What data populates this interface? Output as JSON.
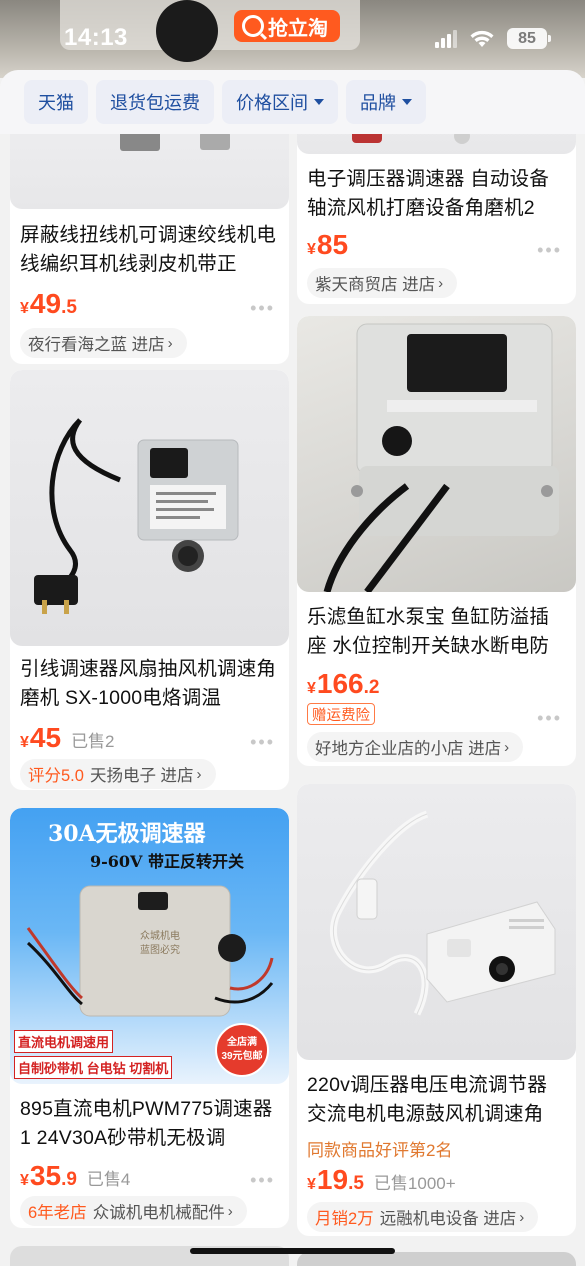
{
  "status": {
    "time": "14:13",
    "app_badge": "抢立淘",
    "battery": "85"
  },
  "filters": [
    {
      "label": "天猫",
      "dropdown": false
    },
    {
      "label": "退货包运费",
      "dropdown": false
    },
    {
      "label": "价格区间",
      "dropdown": true
    },
    {
      "label": "品牌",
      "dropdown": true
    }
  ],
  "products": [
    {
      "title": "屏蔽线扭线机可调速绞线机电线编织耳机线剥皮机带正",
      "price_currency": "¥",
      "price_int": "49",
      "price_dec": ".5",
      "sold": "",
      "shop_highlight": "",
      "shop": "夜行看海之蓝 进店",
      "tag": "",
      "rank": ""
    },
    {
      "title": "电子调压器调速器 自动设备轴流风机打磨设备角磨机2",
      "price_currency": "¥",
      "price_int": "85",
      "price_dec": "",
      "sold": "",
      "shop_highlight": "",
      "shop": "紫天商贸店 进店",
      "tag": "",
      "rank": ""
    },
    {
      "title": "引线调速器风扇抽风机调速角磨机 SX-1000电烙调温",
      "price_currency": "¥",
      "price_int": "45",
      "price_dec": "",
      "sold": "已售2",
      "shop_highlight": "评分5.0",
      "shop": "天扬电子 进店",
      "tag": "",
      "rank": ""
    },
    {
      "title": "乐滤鱼缸水泵宝 鱼缸防溢插座 水位控制开关缺水断电防",
      "price_currency": "¥",
      "price_int": "166",
      "price_dec": ".2",
      "sold": "",
      "shop_highlight": "",
      "shop": "好地方企业店的小店 进店",
      "tag": "赠运费险",
      "rank": ""
    },
    {
      "title": "895直流电机PWM775调速器1 24V30A砂带机无极调",
      "price_currency": "¥",
      "price_int": "35",
      "price_dec": ".9",
      "sold": "已售4",
      "shop_highlight": "6年老店",
      "shop": "众诚机电机械配件",
      "tag": "",
      "rank": "",
      "image_text": {
        "headline": "30A无极调速器",
        "subline": "9-60V 带正反转开关",
        "box_text": "众城机电\n蓝图必究",
        "label1": "直流电机调速用",
        "label2": "自制砂带机 台电钻 切割机",
        "promo": "全店满\n39元包邮"
      }
    },
    {
      "title": "220v调压器电压电流调节器交流电机电源鼓风机调速角",
      "price_currency": "¥",
      "price_int": "19",
      "price_dec": ".5",
      "sold": "已售1000+",
      "shop_highlight": "月销2万",
      "shop": "远融机电设备 进店",
      "tag": "",
      "rank": "同款商品好评第2名"
    }
  ]
}
